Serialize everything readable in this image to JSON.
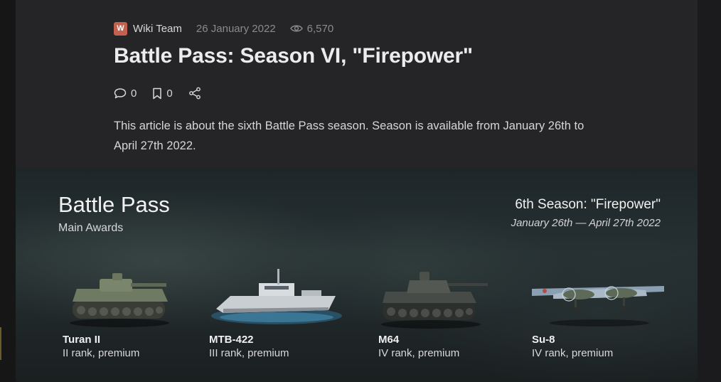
{
  "article": {
    "author_initial": "W",
    "author_name": "Wiki Team",
    "date": "26 January 2022",
    "views": "6,570",
    "title": "Battle Pass: Season VI, \"Firepower\"",
    "comments_count": "0",
    "bookmarks_count": "0",
    "lead": "This article is about the sixth Battle Pass season. Season is available from January 26th to April 27th 2022."
  },
  "banner": {
    "title": "Battle Pass",
    "subtitle": "Main Awards",
    "season_name": "6th Season: \"Firepower\"",
    "season_dates": "January 26th — April 27th 2022",
    "awards": [
      {
        "name": "Turan II",
        "rank": "II rank, premium",
        "icon": "tank-icon"
      },
      {
        "name": "MTB-422",
        "rank": "III rank, premium",
        "icon": "boat-icon"
      },
      {
        "name": "M64",
        "rank": "IV rank, premium",
        "icon": "tank-icon"
      },
      {
        "name": "Su-8",
        "rank": "IV rank, premium",
        "icon": "aircraft-icon"
      }
    ]
  },
  "colors": {
    "card_bg": "#252527",
    "author_badge": "#c4604e",
    "banner_bg": "#232c2e"
  }
}
